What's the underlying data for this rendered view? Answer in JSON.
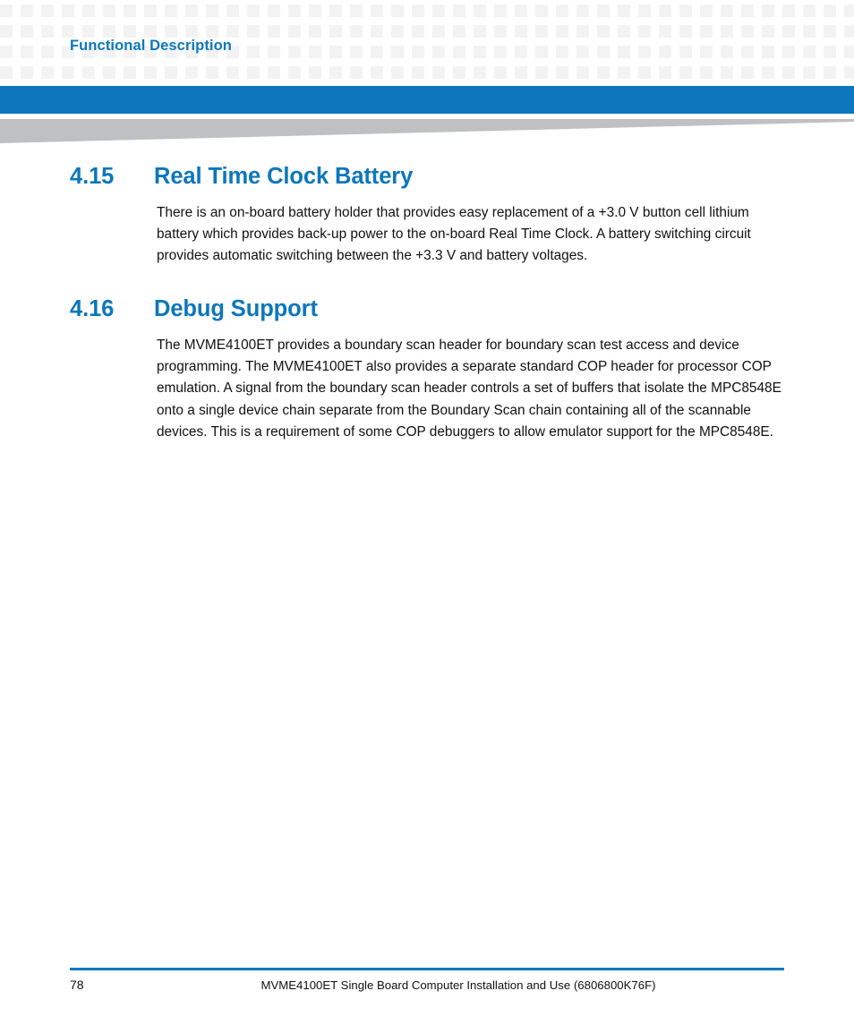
{
  "banner": {
    "running_header": "Functional Description",
    "accent_color": "#0c77bc",
    "dot_color": "#f3f3f3",
    "wedge_color": "#bfc0c2"
  },
  "sections": [
    {
      "number": "4.15",
      "title": "Real Time Clock Battery",
      "body": "There is an on-board battery holder that provides easy replacement of a +3.0 V button cell lithium battery which provides back-up power to the on-board Real Time Clock. A battery switching circuit provides automatic switching between the +3.3 V and battery voltages."
    },
    {
      "number": "4.16",
      "title": "Debug Support",
      "body": "The MVME4100ET provides a boundary scan header for boundary scan test access and device programming. The MVME4100ET also provides a separate standard COP header for processor COP emulation. A signal from the boundary scan header controls a set of buffers that isolate the MPC8548E onto a single device chain separate from the Boundary Scan chain containing all of the scannable devices. This is a requirement of some COP debuggers to allow emulator support for the MPC8548E."
    }
  ],
  "footer": {
    "page_number": "78",
    "document_title": "MVME4100ET Single Board Computer Installation and Use (6806800K76F)"
  }
}
